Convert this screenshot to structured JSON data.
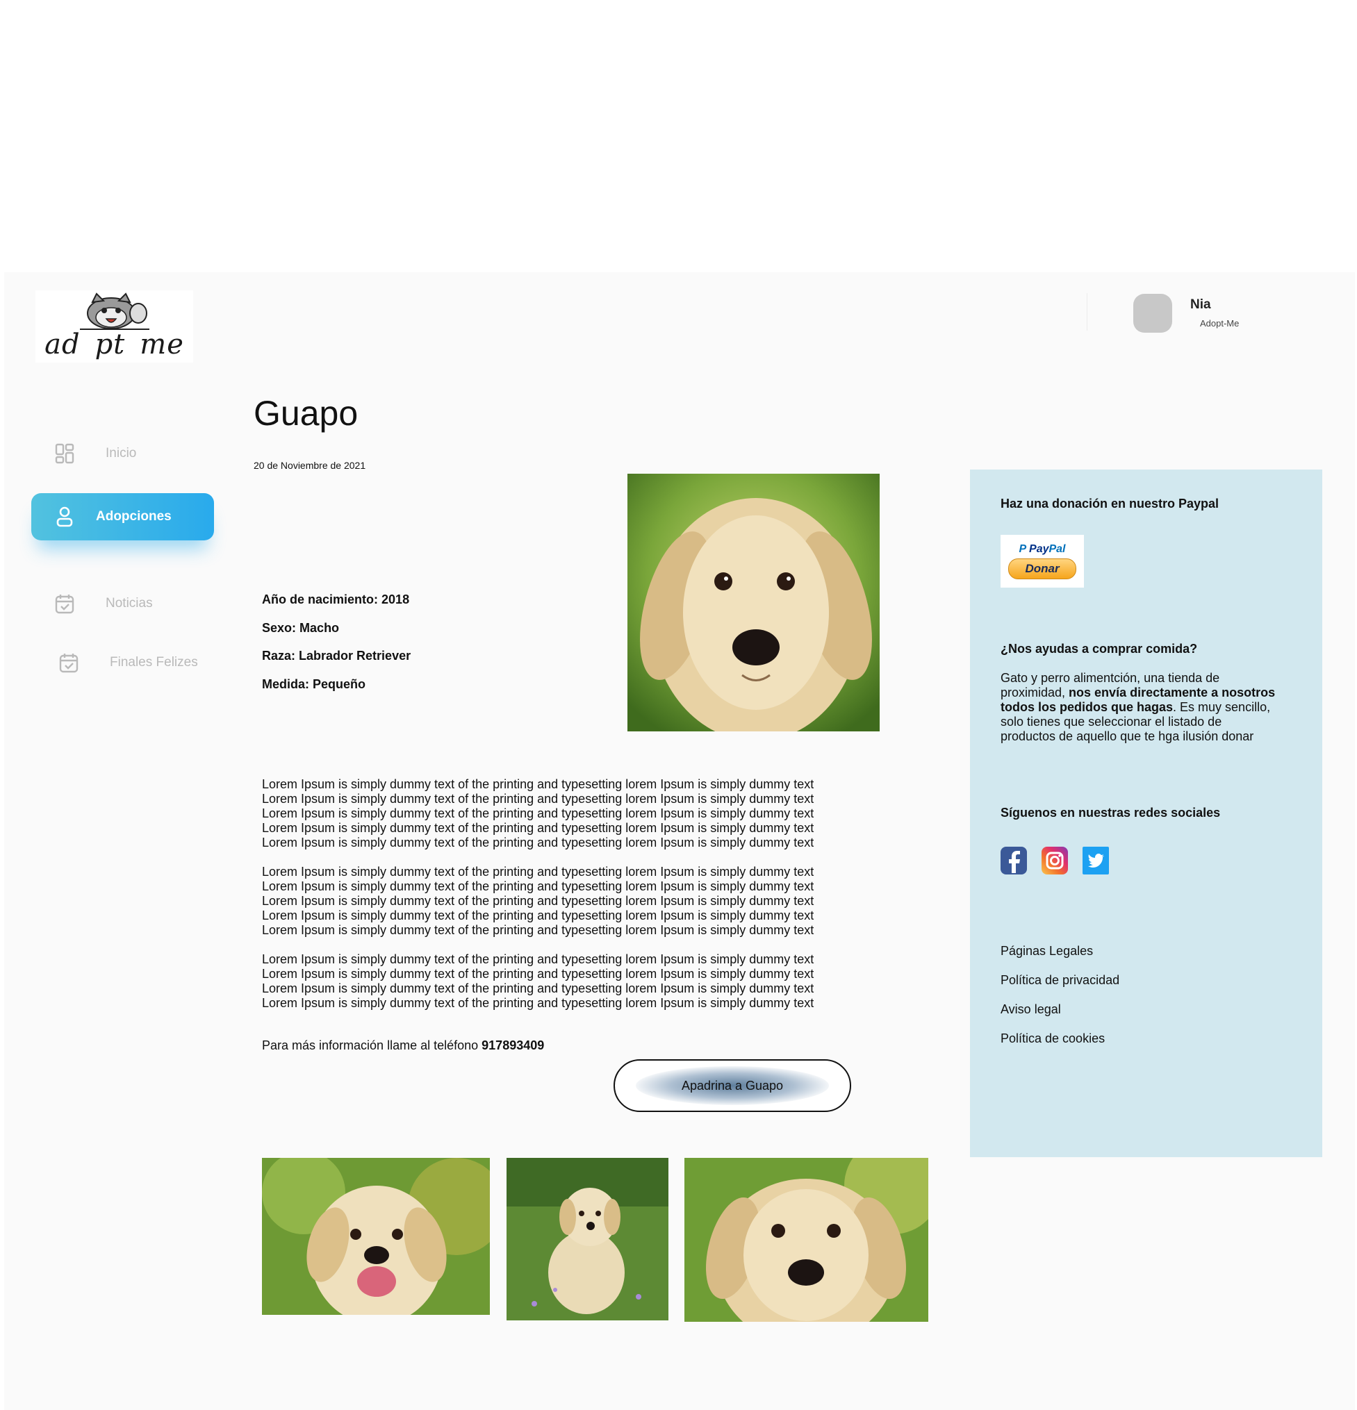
{
  "brand": {
    "logo_text": "ad pt me"
  },
  "user": {
    "name": "Nia",
    "subtitle": "Adopt-Me"
  },
  "sidebar": {
    "items": [
      {
        "label": "Inicio"
      },
      {
        "label": "Adopciones",
        "active": true
      },
      {
        "label": "Noticias"
      },
      {
        "label": "Finales Felizes"
      }
    ]
  },
  "pet": {
    "name": "Guapo",
    "date": "20 de Noviembre  de 2021",
    "facts": [
      {
        "label": "Año de nacimiento:",
        "value": "2018"
      },
      {
        "label": "Sexo:",
        "value": "Macho"
      },
      {
        "label": "Raza:",
        "value": "Labrador Retriever"
      },
      {
        "label": "Medida:",
        "value": "Pequeño"
      }
    ],
    "paragraphs": [
      "Lorem Ipsum is simply dummy text of the printing and typesetting  lorem Ipsum is simply dummy text\nLorem Ipsum is simply dummy text of the printing and typesetting  lorem Ipsum is simply dummy text\nLorem Ipsum is simply dummy text of the printing and typesetting  lorem Ipsum is simply dummy text\nLorem Ipsum is simply dummy text of the printing and typesetting  lorem Ipsum is simply dummy text\nLorem Ipsum is simply dummy text of the printing and typesetting  lorem Ipsum is simply dummy text",
      "Lorem Ipsum is simply dummy text of the printing and typesetting  lorem Ipsum is simply dummy text\nLorem Ipsum is simply dummy text of the printing and typesetting  lorem Ipsum is simply dummy text\nLorem Ipsum is simply dummy text of the printing and typesetting  lorem Ipsum is simply dummy text\nLorem Ipsum is simply dummy text of the printing and typesetting  lorem Ipsum is simply dummy text\nLorem Ipsum is simply dummy text of the printing and typesetting  lorem Ipsum is simply dummy text",
      "Lorem Ipsum is simply dummy text of the printing and typesetting  lorem Ipsum is simply dummy text\nLorem Ipsum is simply dummy text of the printing and typesetting  lorem Ipsum is simply dummy text\nLorem Ipsum is simply dummy text of the printing and typesetting  lorem Ipsum is simply dummy text\nLorem Ipsum is simply dummy text of the printing and typesetting  lorem Ipsum is simply dummy text"
    ],
    "contact_prefix": "Para más información llame al teléfono ",
    "phone": "917893409",
    "cta_label": "Apadrina a Guapo"
  },
  "side_panel": {
    "donation_heading": "Haz una donación en nuestro Paypal",
    "paypal_logo_a": "Pay",
    "paypal_logo_b": "Pal",
    "paypal_button": "Donar",
    "food_heading": "¿Nos ayudas a comprar comida?",
    "food_text_1": "Gato y perro alimentción, una tienda de proximidad, ",
    "food_text_bold": "nos envía directamente a nosotros todos los pedidos que hagas",
    "food_text_2": ". Es muy sencillo, solo tienes que seleccionar el listado de productos de aquello que te hga ilusión donar",
    "social_heading": "Síguenos en nuestras redes sociales",
    "social_icons": [
      "facebook-icon",
      "instagram-icon",
      "twitter-icon"
    ],
    "legal_links": [
      "Páginas Legales",
      "Política de privacidad",
      "Aviso legal",
      "Política de cookies"
    ]
  },
  "colors": {
    "accent": "#29aaec",
    "panel_bg": "#d2e8ef",
    "facebook": "#3b5998",
    "twitter": "#1da1f2"
  }
}
